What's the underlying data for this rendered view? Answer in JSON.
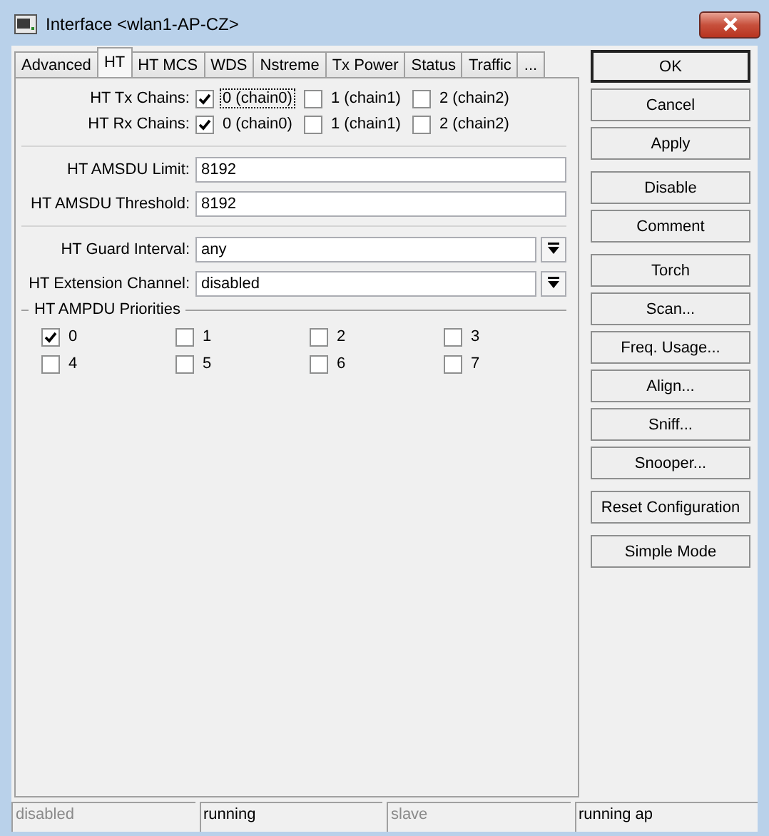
{
  "window": {
    "title": "Interface <wlan1-AP-CZ>"
  },
  "tabs": [
    {
      "label": "Advanced",
      "selected": false
    },
    {
      "label": "HT",
      "selected": true
    },
    {
      "label": "HT MCS",
      "selected": false
    },
    {
      "label": "WDS",
      "selected": false
    },
    {
      "label": "Nstreme",
      "selected": false
    },
    {
      "label": "Tx Power",
      "selected": false
    },
    {
      "label": "Status",
      "selected": false
    },
    {
      "label": "Traffic",
      "selected": false
    },
    {
      "label": "...",
      "selected": false
    }
  ],
  "chains": [
    {
      "label": "HT Tx Chains:",
      "options": [
        {
          "label": "0 (chain0)",
          "checked": true,
          "focused": true
        },
        {
          "label": "1 (chain1)",
          "checked": false,
          "focused": false
        },
        {
          "label": "2 (chain2)",
          "checked": false,
          "focused": false
        }
      ]
    },
    {
      "label": "HT Rx Chains:",
      "options": [
        {
          "label": "0 (chain0)",
          "checked": true,
          "focused": false
        },
        {
          "label": "1 (chain1)",
          "checked": false,
          "focused": false
        },
        {
          "label": "2 (chain2)",
          "checked": false,
          "focused": false
        }
      ]
    }
  ],
  "sections": [
    [
      {
        "kind": "text",
        "label": "HT AMSDU Limit:",
        "value": "8192"
      },
      {
        "kind": "text",
        "label": "HT AMSDU Threshold:",
        "value": "8192"
      }
    ],
    [
      {
        "kind": "dropdown",
        "label": "HT Guard Interval:",
        "value": "any"
      },
      {
        "kind": "dropdown",
        "label": "HT Extension Channel:",
        "value": "disabled"
      }
    ]
  ],
  "ampdu": {
    "title": "HT AMPDU Priorities",
    "items": [
      {
        "label": "0",
        "checked": true
      },
      {
        "label": "1",
        "checked": false
      },
      {
        "label": "2",
        "checked": false
      },
      {
        "label": "3",
        "checked": false
      },
      {
        "label": "4",
        "checked": false
      },
      {
        "label": "5",
        "checked": false
      },
      {
        "label": "6",
        "checked": false
      },
      {
        "label": "7",
        "checked": false
      }
    ]
  },
  "button_groups": [
    [
      {
        "label": "OK",
        "default": true
      },
      {
        "label": "Cancel",
        "default": false
      },
      {
        "label": "Apply",
        "default": false
      }
    ],
    [
      {
        "label": "Disable",
        "default": false
      },
      {
        "label": "Comment",
        "default": false
      }
    ],
    [
      {
        "label": "Torch",
        "default": false
      },
      {
        "label": "Scan...",
        "default": false
      },
      {
        "label": "Freq. Usage...",
        "default": false
      },
      {
        "label": "Align...",
        "default": false
      },
      {
        "label": "Sniff...",
        "default": false
      },
      {
        "label": "Snooper...",
        "default": false
      }
    ],
    [
      {
        "label": "Reset Configuration",
        "default": false
      }
    ],
    [
      {
        "label": "Simple Mode",
        "default": false
      }
    ]
  ],
  "status_bar": [
    {
      "text": "disabled",
      "greyed": true
    },
    {
      "text": "running",
      "greyed": false
    },
    {
      "text": "slave",
      "greyed": true
    },
    {
      "text": "running ap",
      "greyed": false
    }
  ]
}
